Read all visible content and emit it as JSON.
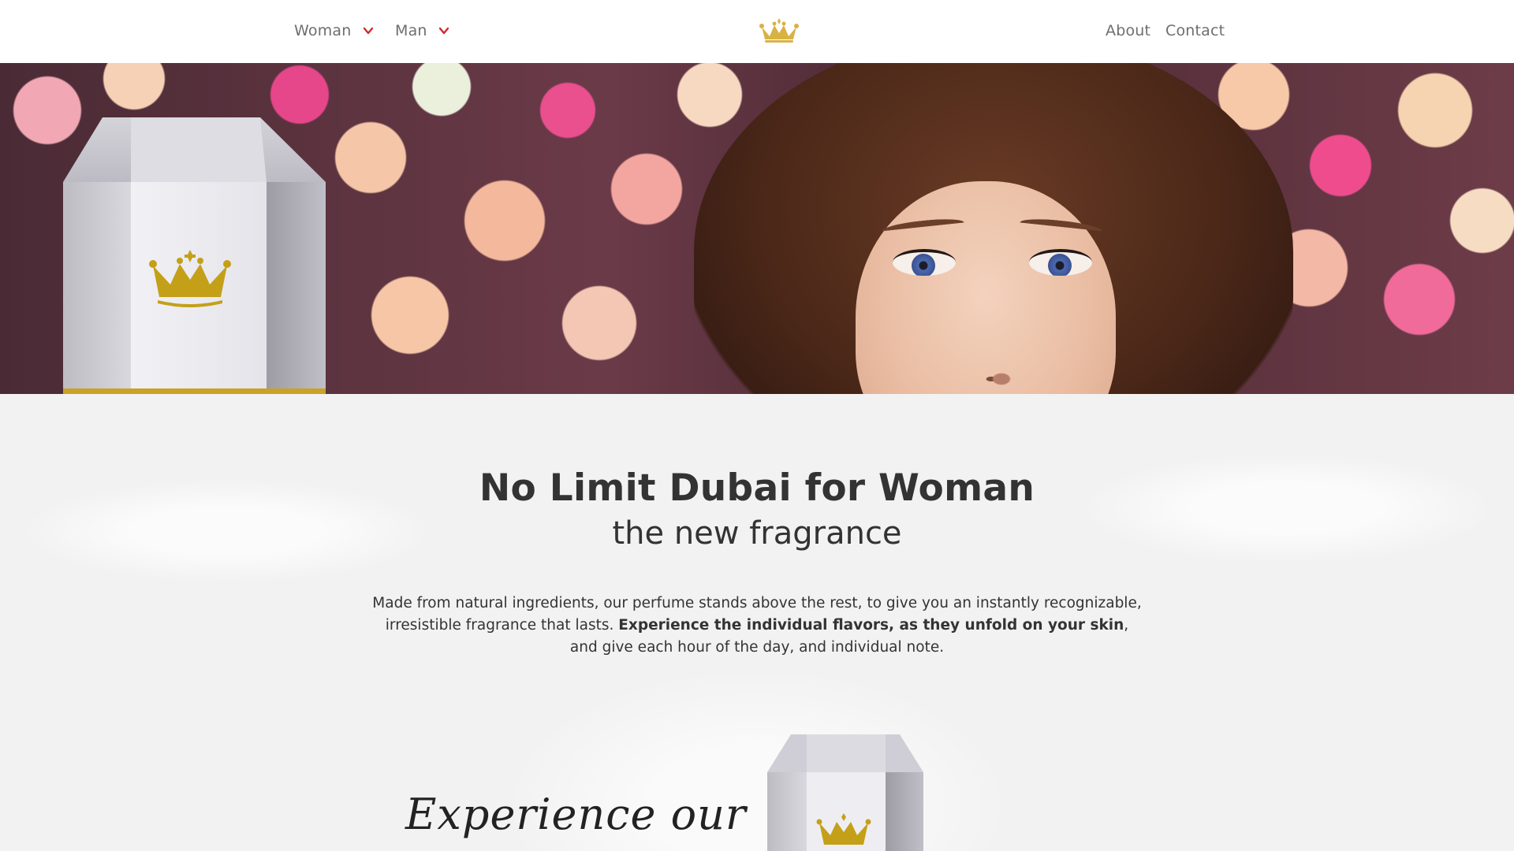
{
  "nav": {
    "left_items": [
      {
        "label": "Woman",
        "icon": "chevron-down-icon"
      },
      {
        "label": "Man",
        "icon": "chevron-down-icon"
      }
    ],
    "right_items": [
      {
        "label": "About"
      },
      {
        "label": "Contact"
      }
    ],
    "logo_icon": "crown-icon"
  },
  "colors": {
    "accent_red": "#d2282f",
    "gold": "#c9a227",
    "text": "#333333",
    "nav_text": "#6e6e6e"
  },
  "product": {
    "title": "No Limit Dubai for Woman",
    "subtitle": "the new fragrance",
    "description_part1": "Made from natural ingredients, our perfume stands above the rest, to give you an instantly recognizable, irresistible fragrance that lasts. ",
    "description_bold": "Experience the individual flavors, as they unfold on your skin",
    "description_part2": ", and give each hour of the day, and individual note."
  },
  "section": {
    "script_heading": "Experience our"
  }
}
